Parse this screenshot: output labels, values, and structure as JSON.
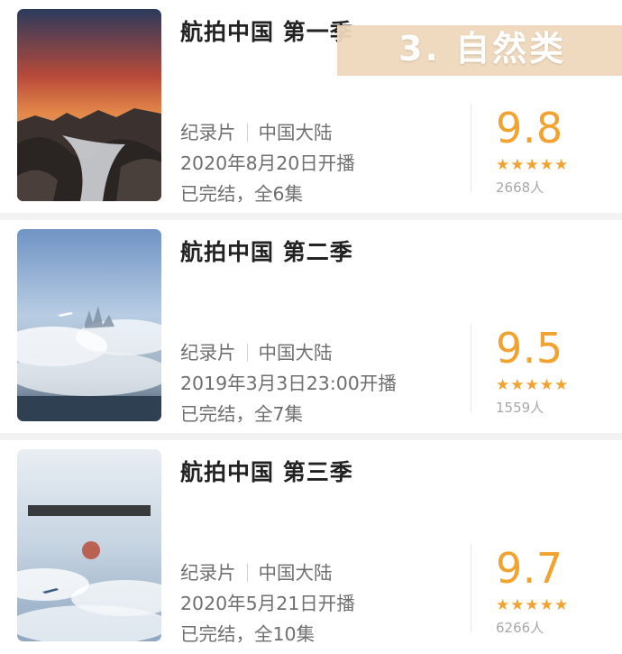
{
  "banner": {
    "text": "3. 自然类"
  },
  "items": [
    {
      "title": "航拍中国 第一季",
      "genre": "纪录片",
      "region": "中国大陆",
      "premiere": "2020年8月20日开播",
      "status": "已完结，全6集",
      "score": "9.8",
      "stars": "★★★★★",
      "count": "2668人",
      "poster_icon": "poster-coastal-sunset"
    },
    {
      "title": "航拍中国 第二季",
      "genre": "纪录片",
      "region": "中国大陆",
      "premiere": "2019年3月3日23:00开播",
      "status": "已完结，全7集",
      "score": "9.5",
      "stars": "★★★★★",
      "count": "1559人",
      "poster_icon": "poster-cloud-city"
    },
    {
      "title": "航拍中国 第三季",
      "genre": "纪录片",
      "region": "中国大陆",
      "premiere": "2020年5月21日开播",
      "status": "已完结，全10集",
      "score": "9.7",
      "stars": "★★★★★",
      "count": "6266人",
      "poster_icon": "poster-sky-flight"
    }
  ],
  "colors": {
    "accent": "#f2a22e",
    "banner": "#eed8bd",
    "separator": "#f2f2f2"
  }
}
